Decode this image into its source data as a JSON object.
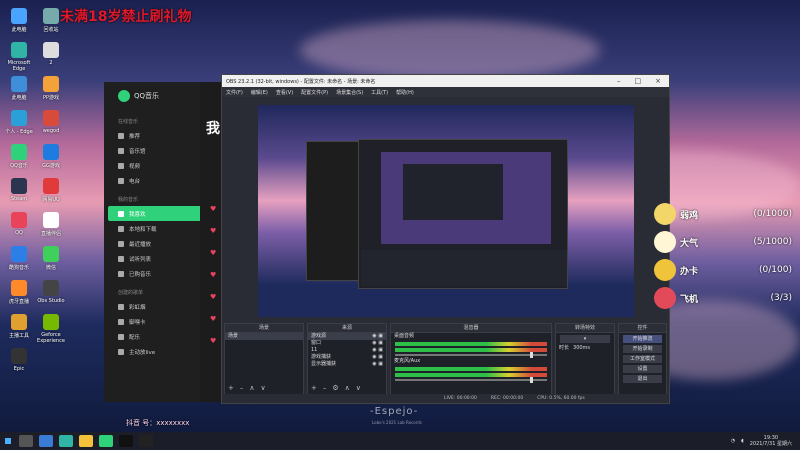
{
  "watermark": "未满18岁禁止刷礼物",
  "desktop_icons": [
    {
      "label": "此电脑",
      "color": "#4aa3ff"
    },
    {
      "label": "回收站",
      "color": "#7aa"
    },
    {
      "label": "Microsoft Edge",
      "color": "#2fb4a6"
    },
    {
      "label": "2",
      "color": "#ddd"
    },
    {
      "label": "此电脑",
      "color": "#3f8fd8"
    },
    {
      "label": "PP游戏",
      "color": "#f3a23a"
    },
    {
      "label": "个人 - Edge",
      "color": "#2a9fd8"
    },
    {
      "label": "wegod",
      "color": "#d84a3a"
    },
    {
      "label": "QQ音乐",
      "color": "#2fd27a"
    },
    {
      "label": "GG游戏",
      "color": "#1e7be0"
    },
    {
      "label": "Steam",
      "color": "#2a3550"
    },
    {
      "label": "网易UU",
      "color": "#e03a3a"
    },
    {
      "label": "QQ",
      "color": "#e9435a"
    },
    {
      "label": "直播伴侣",
      "color": "#ffffff"
    },
    {
      "label": "酷狗音乐",
      "color": "#2b7fe6"
    },
    {
      "label": "微信",
      "color": "#3fcf5b"
    },
    {
      "label": "虎牙直播",
      "color": "#ff8a2a"
    },
    {
      "label": "Obs Studio",
      "color": "#444"
    },
    {
      "label": "主播工具",
      "color": "#e0a030"
    },
    {
      "label": "Geforce Experience",
      "color": "#76b900"
    },
    {
      "label": "Epic",
      "color": "#333"
    }
  ],
  "qqmusic": {
    "title": "QQ音乐",
    "section_online": "在线音乐",
    "online_items": [
      "推荐",
      "音乐馆",
      "视频",
      "电台"
    ],
    "section_mine": "我的音乐",
    "mine_items": [
      "我喜欢",
      "本地和下载",
      "最近播放",
      "试听列表",
      "已购音乐"
    ],
    "active_item": "我喜欢",
    "section_created": "创建的歌单",
    "created_items": [
      "彩虹烟",
      "御嘿卡",
      "配乐",
      "主动放live"
    ],
    "main_title": "我"
  },
  "obs": {
    "title": "OBS 23.2.1 (32-bit, windows) - 配置文件: 未命名 - 场景: 未命名",
    "menu": [
      "文件(F)",
      "编辑(E)",
      "查看(V)",
      "配置文件(P)",
      "场景集合(S)",
      "工具(T)",
      "帮助(H)"
    ],
    "docks": {
      "scenes": {
        "header": "场景",
        "items": [
          "场景"
        ]
      },
      "sources": {
        "header": "来源",
        "items": [
          "游戏源",
          "窗口",
          "11",
          "游戏捕获",
          "显示器捕获"
        ]
      },
      "mixer": {
        "header": "混音器",
        "tracks": [
          "桌面音频",
          "麦克风/Aux"
        ]
      },
      "transitions": {
        "header": "转场特效",
        "label": "时长",
        "duration": "300ms"
      },
      "controls": {
        "header": "控件",
        "buttons": [
          "开始推流",
          "开始录制",
          "工作室模式",
          "设置",
          "退出"
        ]
      }
    },
    "status": [
      "LIVE: 00:00:00",
      "REC: 00:00:00",
      "CPU: 0.5%, 60.00 fps"
    ]
  },
  "gifts": [
    {
      "name": "弱鸡",
      "count": "(0/1000)",
      "color": "#f2d66a"
    },
    {
      "name": "大气",
      "count": "(5/1000)",
      "color": "#fff6d6"
    },
    {
      "name": "办卡",
      "count": "(0/100)",
      "color": "#f0c43a"
    },
    {
      "name": "飞机",
      "count": "(3/3)",
      "color": "#e24a5a"
    }
  ],
  "espejo": {
    "title": "-Espejo-",
    "subtitle": "Lobo's 2021 Lab Records"
  },
  "douyin": "抖音 号：xxxxxxxx",
  "taskbar": {
    "time": "19:30",
    "date": "2021/7/31 星期六"
  }
}
